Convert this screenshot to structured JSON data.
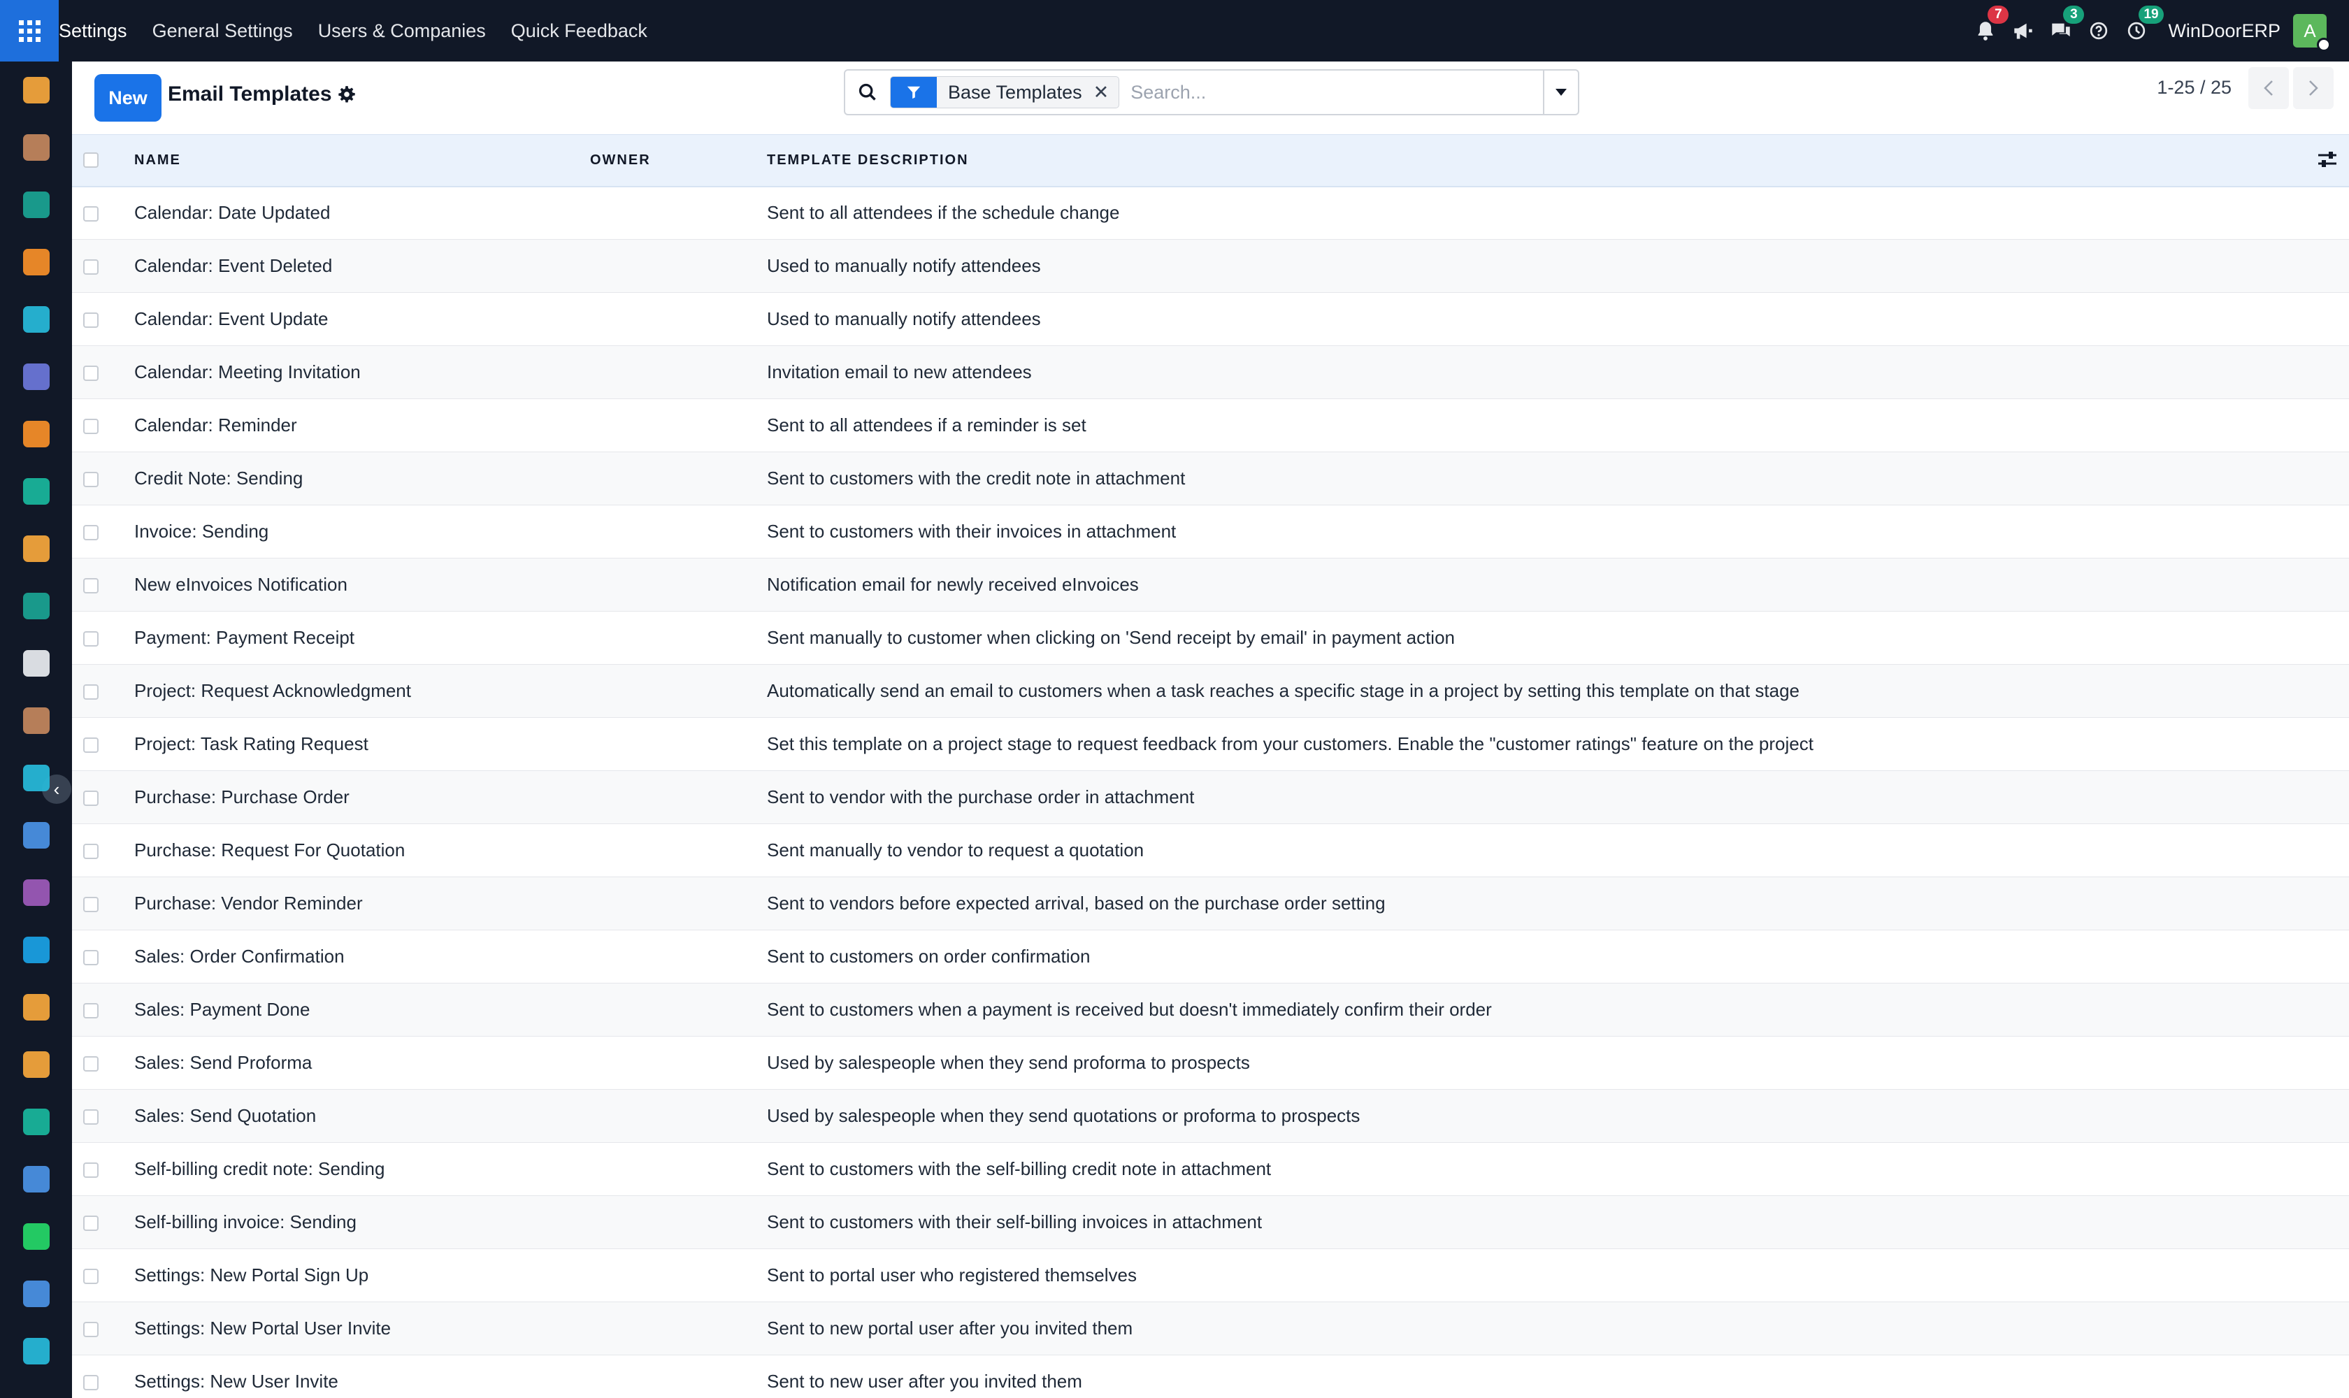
{
  "topbar": {
    "menu": [
      "Settings",
      "General Settings",
      "Users & Companies",
      "Quick Feedback"
    ],
    "notifications_count": "7",
    "messages_count": "3",
    "activities_count": "19",
    "company": "WinDoorERP",
    "avatar_letter": "A"
  },
  "sidebar": {
    "collapse_glyph": "‹",
    "apps": [
      {
        "icon": "sales-app-icon",
        "color": "#f1a33b"
      },
      {
        "icon": "notes-app-icon",
        "color": "#c0845c"
      },
      {
        "icon": "contacts-app-icon",
        "color": "#1aa090"
      },
      {
        "icon": "chat-app-icon",
        "color": "#f28c28"
      },
      {
        "icon": "website-app-icon",
        "color": "#27b6d6"
      },
      {
        "icon": "email-marketing-app-icon",
        "color": "#6a75d6"
      },
      {
        "icon": "discuss-app-icon",
        "color": "#f28c28"
      },
      {
        "icon": "crm-app-icon",
        "color": "#19b39a"
      },
      {
        "icon": "reporting-app-icon",
        "color": "#f1a33b"
      },
      {
        "icon": "employees-app-icon",
        "color": "#1aa090"
      },
      {
        "icon": "inventory-app-icon",
        "color": "#e5e7eb"
      },
      {
        "icon": "purchase-app-icon",
        "color": "#c0845c"
      },
      {
        "icon": "project-app-icon",
        "color": "#27b6d6"
      },
      {
        "icon": "knowledge-app-icon",
        "color": "#4a8fe0"
      },
      {
        "icon": "manufacturing-app-icon",
        "color": "#9b59b6"
      },
      {
        "icon": "invoicing-app-icon",
        "color": "#1a9ee0"
      },
      {
        "icon": "team-app-icon",
        "color": "#f1a33b"
      },
      {
        "icon": "calendar-app-icon",
        "color": "#f1a33b"
      },
      {
        "icon": "sign-app-icon",
        "color": "#19b39a"
      },
      {
        "icon": "dashboards-app-icon",
        "color": "#4a8fe0"
      },
      {
        "icon": "whatsapp-app-icon",
        "color": "#25d366"
      },
      {
        "icon": "timesheet-app-icon",
        "color": "#4a8fe0"
      },
      {
        "icon": "website-2-app-icon",
        "color": "#27b6d6"
      }
    ]
  },
  "control_panel": {
    "new_label": "New",
    "title": "Email Templates",
    "facet_label": "Base Templates",
    "facet_remove": "✕",
    "search_placeholder": "Search...",
    "pager_value": "1-25 / 25"
  },
  "table": {
    "headers": {
      "name": "NAME",
      "owner": "OWNER",
      "description": "TEMPLATE DESCRIPTION"
    },
    "rows": [
      {
        "name": "Calendar: Date Updated",
        "owner": "",
        "description": "Sent to all attendees if the schedule change"
      },
      {
        "name": "Calendar: Event Deleted",
        "owner": "",
        "description": "Used to manually notify attendees"
      },
      {
        "name": "Calendar: Event Update",
        "owner": "",
        "description": "Used to manually notify attendees"
      },
      {
        "name": "Calendar: Meeting Invitation",
        "owner": "",
        "description": "Invitation email to new attendees"
      },
      {
        "name": "Calendar: Reminder",
        "owner": "",
        "description": "Sent to all attendees if a reminder is set"
      },
      {
        "name": "Credit Note: Sending",
        "owner": "",
        "description": "Sent to customers with the credit note in attachment"
      },
      {
        "name": "Invoice: Sending",
        "owner": "",
        "description": "Sent to customers with their invoices in attachment"
      },
      {
        "name": "New eInvoices Notification",
        "owner": "",
        "description": "Notification email for newly received eInvoices"
      },
      {
        "name": "Payment: Payment Receipt",
        "owner": "",
        "description": "Sent manually to customer when clicking on 'Send receipt by email' in payment action"
      },
      {
        "name": "Project: Request Acknowledgment",
        "owner": "",
        "description": "Automatically send an email to customers when a task reaches a specific stage in a project by setting this template on that stage"
      },
      {
        "name": "Project: Task Rating Request",
        "owner": "",
        "description": "Set this template on a project stage to request feedback from your customers. Enable the \"customer ratings\" feature on the project"
      },
      {
        "name": "Purchase: Purchase Order",
        "owner": "",
        "description": "Sent to vendor with the purchase order in attachment"
      },
      {
        "name": "Purchase: Request For Quotation",
        "owner": "",
        "description": "Sent manually to vendor to request a quotation"
      },
      {
        "name": "Purchase: Vendor Reminder",
        "owner": "",
        "description": "Sent to vendors before expected arrival, based on the purchase order setting"
      },
      {
        "name": "Sales: Order Confirmation",
        "owner": "",
        "description": "Sent to customers on order confirmation"
      },
      {
        "name": "Sales: Payment Done",
        "owner": "",
        "description": "Sent to customers when a payment is received but doesn't immediately confirm their order"
      },
      {
        "name": "Sales: Send Proforma",
        "owner": "",
        "description": "Used by salespeople when they send proforma to prospects"
      },
      {
        "name": "Sales: Send Quotation",
        "owner": "",
        "description": "Used by salespeople when they send quotations or proforma to prospects"
      },
      {
        "name": "Self-billing credit note: Sending",
        "owner": "",
        "description": "Sent to customers with the self-billing credit note in attachment"
      },
      {
        "name": "Self-billing invoice: Sending",
        "owner": "",
        "description": "Sent to customers with their self-billing invoices in attachment"
      },
      {
        "name": "Settings: New Portal Sign Up",
        "owner": "",
        "description": "Sent to portal user who registered themselves"
      },
      {
        "name": "Settings: New Portal User Invite",
        "owner": "",
        "description": "Sent to new portal user after you invited them"
      },
      {
        "name": "Settings: New User Invite",
        "owner": "",
        "description": "Sent to new user after you invited them"
      }
    ]
  }
}
